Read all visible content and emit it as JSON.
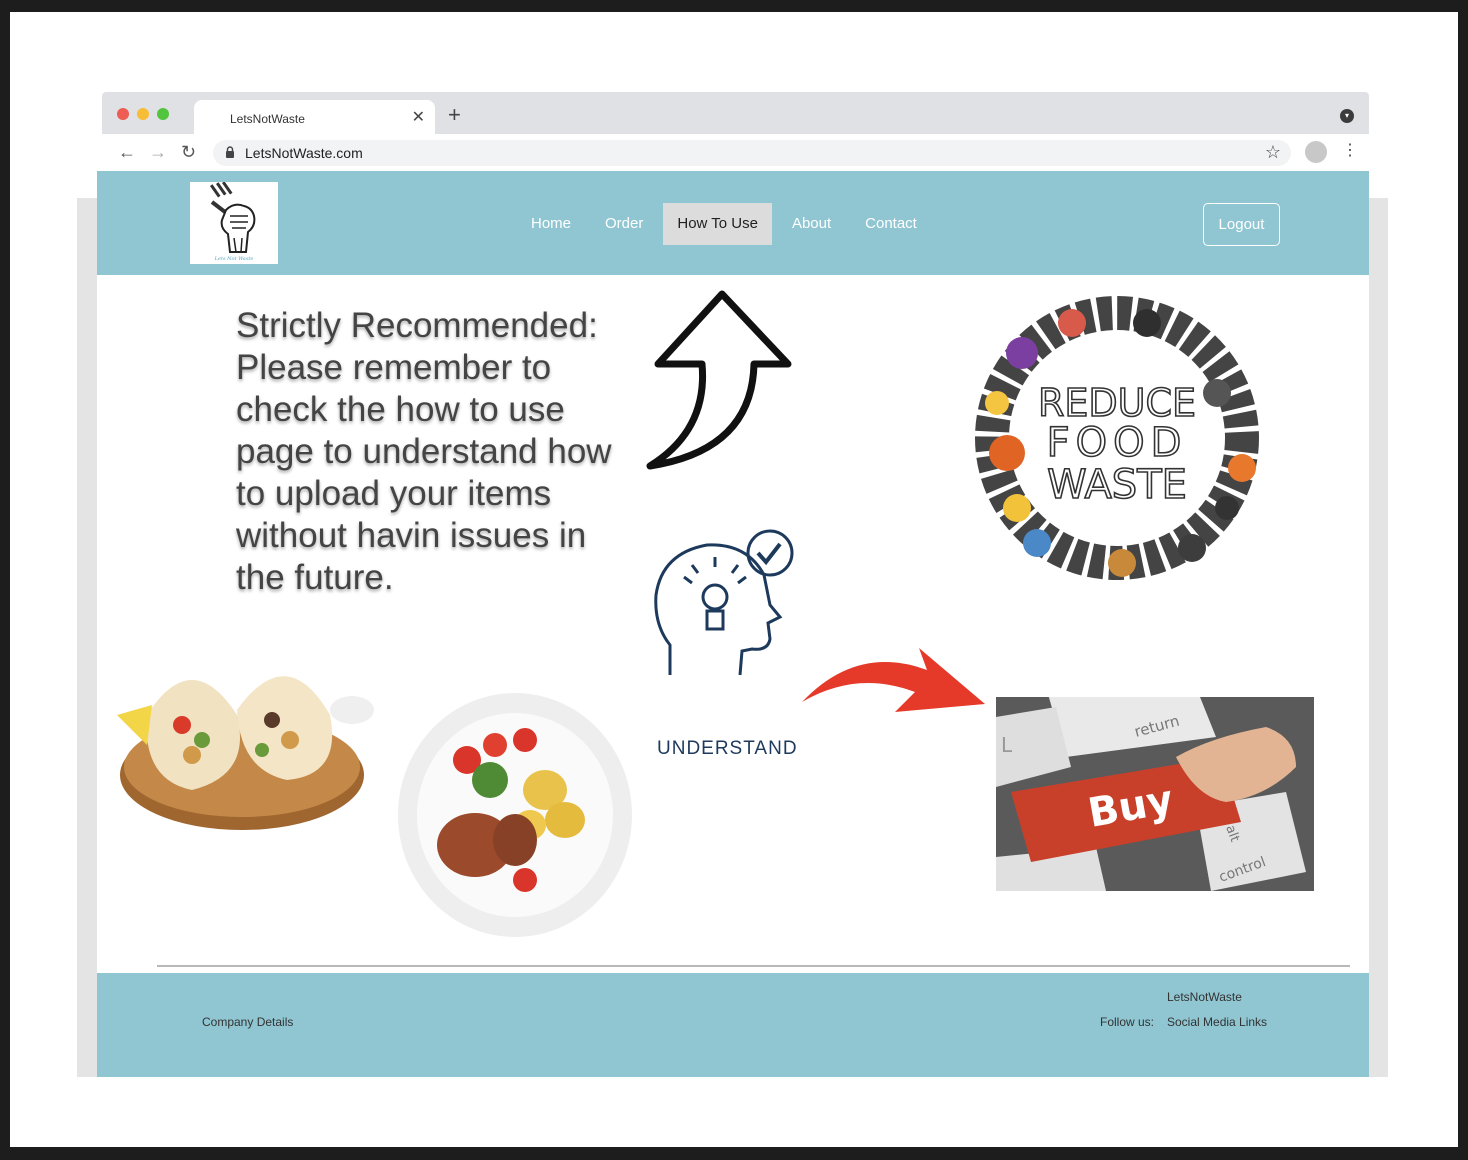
{
  "browser": {
    "tab_title": "LetsNotWaste",
    "tab_close": "✕",
    "new_tab": "+",
    "url": "LetsNotWaste.com",
    "back": "←",
    "forward": "→",
    "reload": "↻",
    "bookmark": "☆",
    "menu": "⋮"
  },
  "header": {
    "nav": [
      "Home",
      "Order",
      "How To Use",
      "About",
      "Contact"
    ],
    "active_nav": "How To Use",
    "logout_label": "Logout",
    "logo_caption": "Lets Not Waste"
  },
  "main": {
    "recommendation": "Strictly Recommended: Please remember to check the how to use page to understand how to upload your items without havin issues in the future.",
    "understand_label": "UNDERSTAND",
    "reduce_badge": [
      "REDUCE",
      "FOOD",
      "WASTE"
    ],
    "buy_key": "Buy",
    "key_labels": [
      "return",
      "alt",
      "control",
      "L"
    ]
  },
  "footer": {
    "company": "Company Details",
    "brand": "LetsNotWaste",
    "follow": "Follow us:",
    "social": "Social Media Links"
  },
  "colors": {
    "header_bg": "#8fc6d2",
    "footer_bg": "#8fc6d2",
    "arrow_red": "#e53a2a",
    "buy_key": "#c8402a"
  }
}
